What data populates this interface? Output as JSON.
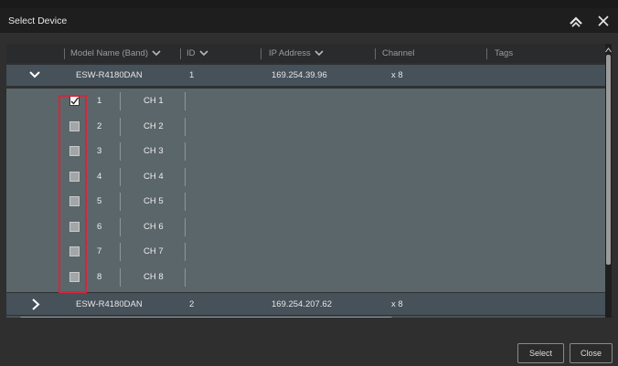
{
  "dialog": {
    "title": "Select Device",
    "select_label": "Select",
    "close_label": "Close"
  },
  "columns": {
    "model": "Model Name (Band)",
    "id": "ID",
    "ip": "IP Address",
    "channel": "Channel",
    "tags": "Tags"
  },
  "devices": [
    {
      "model": "ESW-R4180DAN",
      "id": "1",
      "ip": "169.254.39.96",
      "channel": "x 8",
      "expanded": true
    },
    {
      "model": "ESW-R4180DAN",
      "id": "2",
      "ip": "169.254.207.62",
      "channel": "x 8",
      "expanded": false
    }
  ],
  "channels": [
    {
      "num": "1",
      "name": "CH 1",
      "checked": true
    },
    {
      "num": "2",
      "name": "CH 2",
      "checked": false
    },
    {
      "num": "3",
      "name": "CH 3",
      "checked": false
    },
    {
      "num": "4",
      "name": "CH 4",
      "checked": false
    },
    {
      "num": "5",
      "name": "CH 5",
      "checked": false
    },
    {
      "num": "6",
      "name": "CH 6",
      "checked": false
    },
    {
      "num": "7",
      "name": "CH 7",
      "checked": false
    },
    {
      "num": "8",
      "name": "CH 8",
      "checked": false
    }
  ],
  "colors": {
    "highlight": "#d9253a",
    "row_bg": "#46515a",
    "channel_bg": "#5b666a"
  },
  "icons": {
    "collapse": "chevron-up-icon",
    "close": "close-icon",
    "expanded_row": "chevron-down-icon",
    "collapsed_row": "chevron-right-icon",
    "sort": "chevron-down-icon"
  }
}
